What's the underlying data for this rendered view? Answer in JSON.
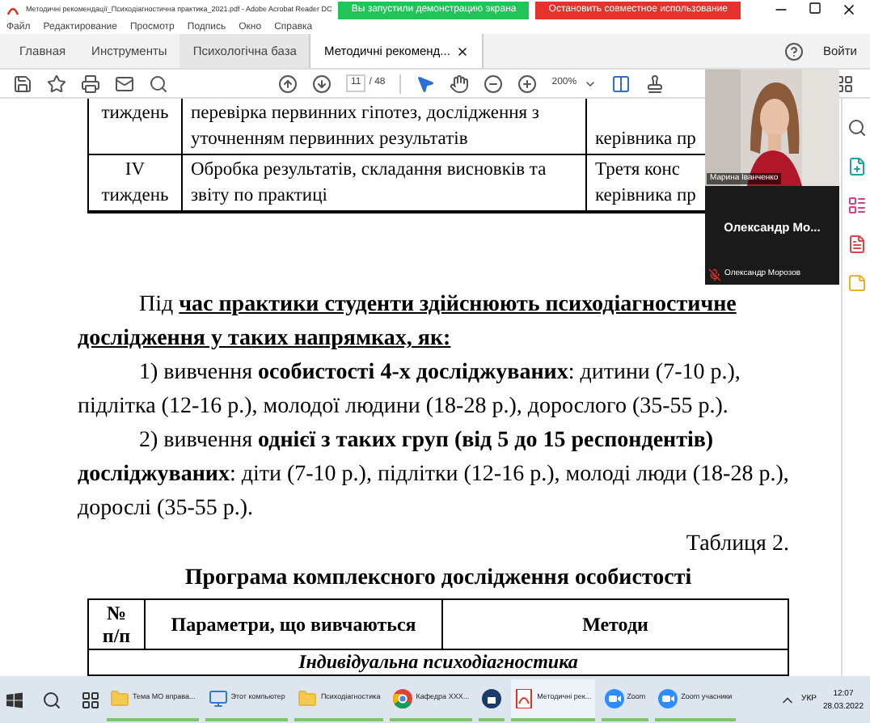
{
  "window": {
    "title": "Методичні рекомендації_Психодіагностична практика_2021.pdf - Adobe Acrobat Reader DC",
    "share_banner": "Вы запустили демонстрацию экрана",
    "stop_share": "Остановить совместное использование"
  },
  "menu": [
    "Файл",
    "Редактирование",
    "Просмотр",
    "Подпись",
    "Окно",
    "Справка"
  ],
  "tabs": [
    {
      "label": "Главная",
      "selected": false,
      "kind": "plain"
    },
    {
      "label": "Инструменты",
      "selected": false,
      "kind": "plain"
    },
    {
      "label": "Психологічна база",
      "selected": false,
      "kind": "doc"
    },
    {
      "label": "Методичні рекоменд...",
      "selected": true,
      "kind": "doc"
    }
  ],
  "sign_in": "Войти",
  "toolbar": {
    "page": "11",
    "pages": "/ 48",
    "zoom": "200%"
  },
  "table1": {
    "rows": [
      {
        "cells": [
          [
            "тиждень"
          ],
          [
            "перевірка первинних гіпотез, дослідження з",
            "уточненням первинних результатів"
          ],
          [
            "",
            "керівника пр"
          ]
        ]
      },
      {
        "cells": [
          [
            "IV",
            "тиждень"
          ],
          [
            "Обробка результатів, складання висновків та",
            "звіту по практиці"
          ],
          [
            "Третя конс",
            "керівника пр"
          ]
        ]
      }
    ]
  },
  "paragraphs": [
    {
      "underline": true,
      "lines": [
        "Під **час практики студенти здійснюють психодіагностичне**",
        "**дослідження у таких напрямках, як:**"
      ]
    },
    {
      "underline": false,
      "lines": [
        "1) вивчення **особистості 4-х досліджуваних**: дитини (7-10 р.),",
        "підлітка (12-16 р.), молодої людини (18-28 р.), дорослого (35-55 р.)."
      ]
    },
    {
      "underline": false,
      "lines": [
        "2) вивчення **однієї з таких груп (від 5 до 15 респондентів)**",
        "**досліджуваних**: діти (7-10 р.), підлітки (12-16 р.), молоді люди (18-28 р.),",
        "дорослі (35-55 р.)."
      ]
    }
  ],
  "caption": "Таблиця 2.",
  "table2": {
    "title": "Програма комплексного дослідження особистості",
    "columns": [
      [
        "№",
        "п/п"
      ],
      [
        "Параметри, що вивчаються"
      ],
      [
        "Методи"
      ]
    ],
    "section": "Індивідуальна психодіагностика"
  },
  "video": {
    "speaker_label": "Марина Іванченко",
    "participant_name": "Олександр Мо...",
    "participant_label": "Олександр Морозов",
    "participant_muted": true
  },
  "taskbar": {
    "items": [
      {
        "label": "Тема МО вправа..."
      },
      {
        "label": "Этот компьютер"
      },
      {
        "label": "Психодіагностика"
      },
      {
        "label": "Кафедра ХХХ..."
      },
      {
        "label": "Методичні рек..."
      },
      {
        "label": "Zoom"
      },
      {
        "label": "Zoom учасники"
      }
    ],
    "lang": "УКР",
    "time": "12:07",
    "date": "28.03.2022"
  }
}
